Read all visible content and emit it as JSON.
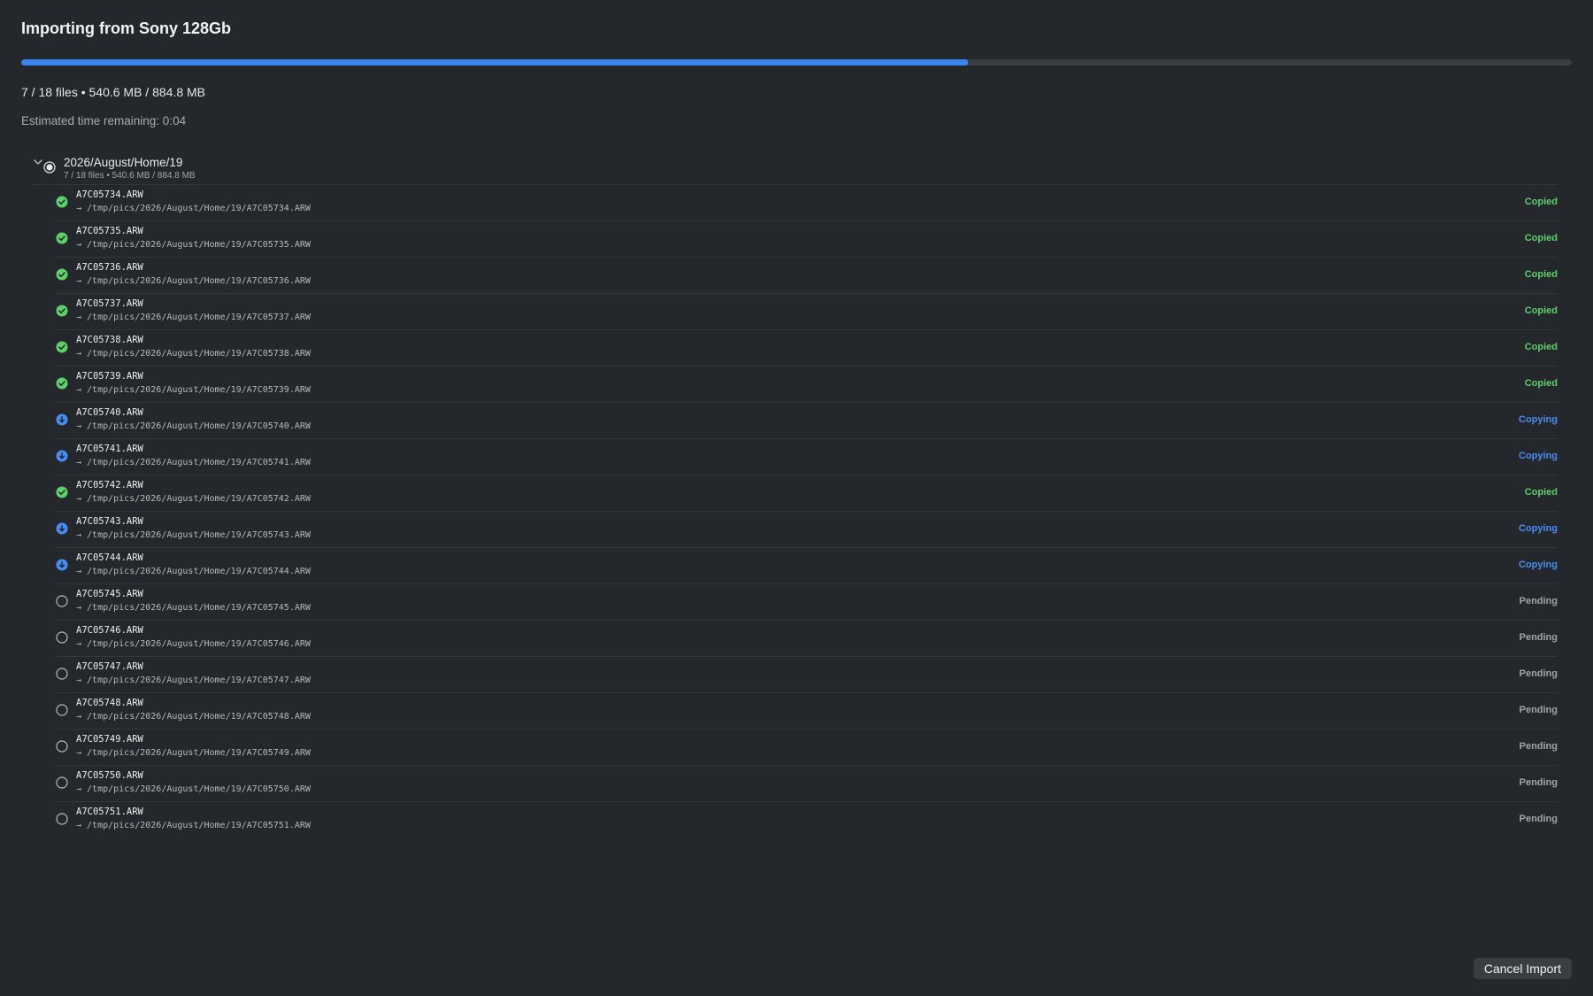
{
  "header": {
    "title": "Importing from Sony 128Gb",
    "progress": 0.611,
    "summary": "7 / 18 files • 540.6 MB / 884.8 MB",
    "eta": "Estimated time remaining: 0:04"
  },
  "colors": {
    "accent": "#3d83f0",
    "copied": "#5fcf6c",
    "copying": "#4a8df2",
    "pending": "#a2a6ab"
  },
  "folder": {
    "name": "2026/August/Home/19",
    "meta": "7 / 18 files • 540.6 MB / 884.8 MB"
  },
  "files": [
    {
      "name": "A7C05734.ARW",
      "dest": "→ /tmp/pics/2026/August/Home/19/A7C05734.ARW",
      "status": "Copied",
      "state": "copied",
      "icon": "check-circle-icon"
    },
    {
      "name": "A7C05735.ARW",
      "dest": "→ /tmp/pics/2026/August/Home/19/A7C05735.ARW",
      "status": "Copied",
      "state": "copied",
      "icon": "check-circle-icon"
    },
    {
      "name": "A7C05736.ARW",
      "dest": "→ /tmp/pics/2026/August/Home/19/A7C05736.ARW",
      "status": "Copied",
      "state": "copied",
      "icon": "check-circle-icon"
    },
    {
      "name": "A7C05737.ARW",
      "dest": "→ /tmp/pics/2026/August/Home/19/A7C05737.ARW",
      "status": "Copied",
      "state": "copied",
      "icon": "check-circle-icon"
    },
    {
      "name": "A7C05738.ARW",
      "dest": "→ /tmp/pics/2026/August/Home/19/A7C05738.ARW",
      "status": "Copied",
      "state": "copied",
      "icon": "check-circle-icon"
    },
    {
      "name": "A7C05739.ARW",
      "dest": "→ /tmp/pics/2026/August/Home/19/A7C05739.ARW",
      "status": "Copied",
      "state": "copied",
      "icon": "check-circle-icon"
    },
    {
      "name": "A7C05740.ARW",
      "dest": "→ /tmp/pics/2026/August/Home/19/A7C05740.ARW",
      "status": "Copying",
      "state": "copying",
      "icon": "download-circle-icon"
    },
    {
      "name": "A7C05741.ARW",
      "dest": "→ /tmp/pics/2026/August/Home/19/A7C05741.ARW",
      "status": "Copying",
      "state": "copying",
      "icon": "download-circle-icon"
    },
    {
      "name": "A7C05742.ARW",
      "dest": "→ /tmp/pics/2026/August/Home/19/A7C05742.ARW",
      "status": "Copied",
      "state": "copied",
      "icon": "check-circle-icon"
    },
    {
      "name": "A7C05743.ARW",
      "dest": "→ /tmp/pics/2026/August/Home/19/A7C05743.ARW",
      "status": "Copying",
      "state": "copying",
      "icon": "download-circle-icon"
    },
    {
      "name": "A7C05744.ARW",
      "dest": "→ /tmp/pics/2026/August/Home/19/A7C05744.ARW",
      "status": "Copying",
      "state": "copying",
      "icon": "download-circle-icon"
    },
    {
      "name": "A7C05745.ARW",
      "dest": "→ /tmp/pics/2026/August/Home/19/A7C05745.ARW",
      "status": "Pending",
      "state": "pending",
      "icon": "empty-circle-icon"
    },
    {
      "name": "A7C05746.ARW",
      "dest": "→ /tmp/pics/2026/August/Home/19/A7C05746.ARW",
      "status": "Pending",
      "state": "pending",
      "icon": "empty-circle-icon"
    },
    {
      "name": "A7C05747.ARW",
      "dest": "→ /tmp/pics/2026/August/Home/19/A7C05747.ARW",
      "status": "Pending",
      "state": "pending",
      "icon": "empty-circle-icon"
    },
    {
      "name": "A7C05748.ARW",
      "dest": "→ /tmp/pics/2026/August/Home/19/A7C05748.ARW",
      "status": "Pending",
      "state": "pending",
      "icon": "empty-circle-icon"
    },
    {
      "name": "A7C05749.ARW",
      "dest": "→ /tmp/pics/2026/August/Home/19/A7C05749.ARW",
      "status": "Pending",
      "state": "pending",
      "icon": "empty-circle-icon"
    },
    {
      "name": "A7C05750.ARW",
      "dest": "→ /tmp/pics/2026/August/Home/19/A7C05750.ARW",
      "status": "Pending",
      "state": "pending",
      "icon": "empty-circle-icon"
    },
    {
      "name": "A7C05751.ARW",
      "dest": "→ /tmp/pics/2026/August/Home/19/A7C05751.ARW",
      "status": "Pending",
      "state": "pending",
      "icon": "empty-circle-icon"
    }
  ],
  "footer": {
    "cancel_label": "Cancel Import"
  }
}
